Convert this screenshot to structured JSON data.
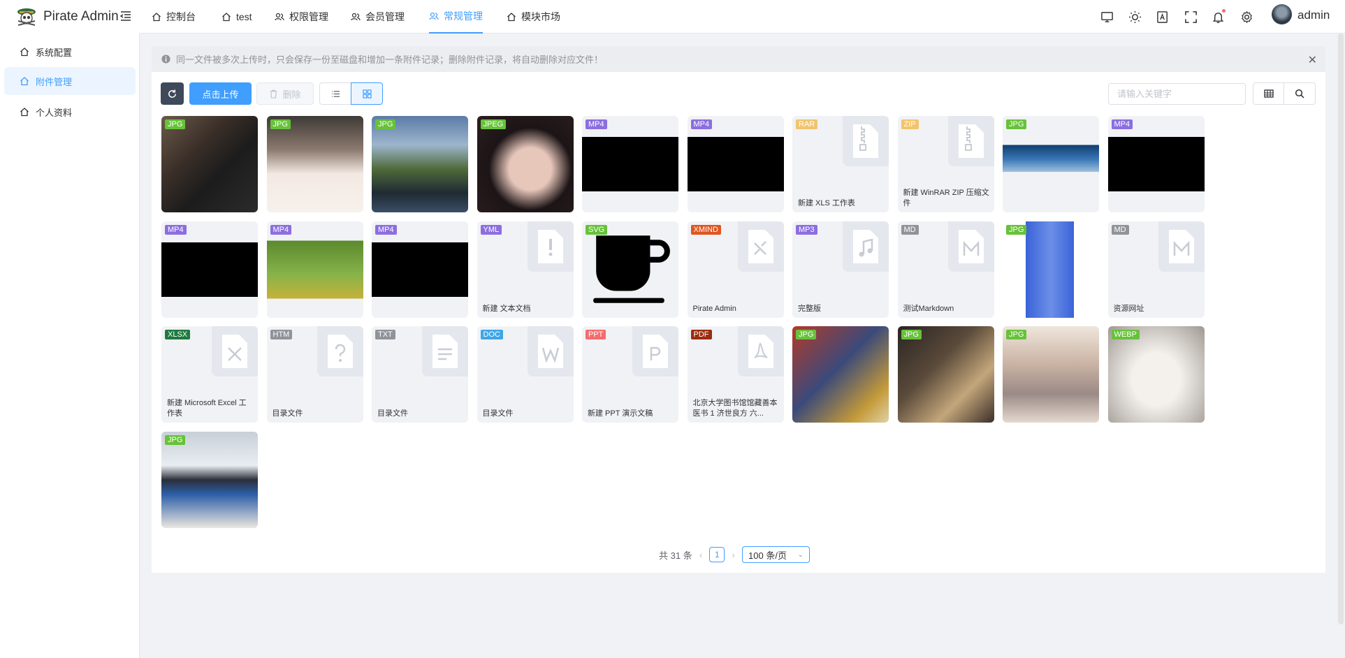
{
  "app": {
    "title": "Pirate Admin"
  },
  "topnav": {
    "tabs": [
      {
        "label": "控制台",
        "icon": "home-icon"
      },
      {
        "label": "test",
        "icon": "home-icon"
      },
      {
        "label": "权限管理",
        "icon": "user-group-icon"
      },
      {
        "label": "会员管理",
        "icon": "user-group-icon"
      },
      {
        "label": "常规管理",
        "icon": "user-group-icon",
        "active": true
      },
      {
        "label": "模块市场",
        "icon": "home-icon"
      }
    ],
    "username": "admin"
  },
  "sidebar": {
    "items": [
      {
        "label": "系统配置",
        "icon": "home-icon"
      },
      {
        "label": "附件管理",
        "icon": "home-icon",
        "active": true
      },
      {
        "label": "个人资料",
        "icon": "home-icon"
      }
    ]
  },
  "alert": {
    "text": "同一文件被多次上传时，只会保存一份至磁盘和增加一条附件记录；删除附件记录，将自动删除对应文件！"
  },
  "toolbar": {
    "upload_label": "点击上传",
    "delete_label": "删除",
    "search_placeholder": "请输入关键字"
  },
  "files": [
    {
      "badge": "JPG",
      "color": "#67c23a",
      "kind": "photo",
      "photo": "p1"
    },
    {
      "badge": "JPG",
      "color": "#67c23a",
      "kind": "photo",
      "photo": "p2"
    },
    {
      "badge": "JPG",
      "color": "#67c23a",
      "kind": "photo",
      "photo": "p3"
    },
    {
      "badge": "JPEG",
      "color": "#67c23a",
      "kind": "photo",
      "photo": "p4"
    },
    {
      "badge": "MP4",
      "color": "#8c6ee0",
      "kind": "video"
    },
    {
      "badge": "MP4",
      "color": "#8c6ee0",
      "kind": "video"
    },
    {
      "badge": "RAR",
      "color": "#f2c46d",
      "kind": "file",
      "icon": "zip",
      "name": "新建 XLS 工作表"
    },
    {
      "badge": "ZIP",
      "color": "#f2c46d",
      "kind": "file",
      "icon": "zip",
      "name": "新建 WinRAR ZIP 压缩文件"
    },
    {
      "badge": "JPG",
      "color": "#67c23a",
      "kind": "photo",
      "photo": "p5"
    },
    {
      "badge": "MP4",
      "color": "#8c6ee0",
      "kind": "video"
    },
    {
      "badge": "MP4",
      "color": "#8c6ee0",
      "kind": "video"
    },
    {
      "badge": "MP4",
      "color": "#8c6ee0",
      "kind": "photo",
      "photo": "bunny"
    },
    {
      "badge": "MP4",
      "color": "#8c6ee0",
      "kind": "video"
    },
    {
      "badge": "YML",
      "color": "#8c6ee0",
      "kind": "file",
      "icon": "exclaim",
      "name": "新建 文本文档"
    },
    {
      "badge": "SVG",
      "color": "#67c23a",
      "kind": "photo",
      "photo": "cup"
    },
    {
      "badge": "XMIND",
      "color": "#e0551f",
      "kind": "file",
      "icon": "xmind",
      "name": "Pirate Admin"
    },
    {
      "badge": "MP3",
      "color": "#8c6ee0",
      "kind": "file",
      "icon": "music",
      "name": "完整版"
    },
    {
      "badge": "MD",
      "color": "#909399",
      "kind": "file",
      "icon": "md",
      "name": "测试Markdown"
    },
    {
      "badge": "JPG",
      "color": "#67c23a",
      "kind": "photo",
      "photo": "poster"
    },
    {
      "badge": "MD",
      "color": "#909399",
      "kind": "file",
      "icon": "md",
      "name": "资源网址"
    },
    {
      "badge": "XLSX",
      "color": "#1f7a3f",
      "kind": "file",
      "icon": "x",
      "name": "新建 Microsoft Excel 工作表"
    },
    {
      "badge": "HTM",
      "color": "#909399",
      "kind": "file",
      "icon": "question",
      "name": "目录文件"
    },
    {
      "badge": "TXT",
      "color": "#909399",
      "kind": "file",
      "icon": "text",
      "name": "目录文件"
    },
    {
      "badge": "DOC",
      "color": "#3ea6e8",
      "kind": "file",
      "icon": "w",
      "name": "目录文件"
    },
    {
      "badge": "PPT",
      "color": "#f56c6c",
      "kind": "file",
      "icon": "p",
      "name": "新建 PPT 演示文稿"
    },
    {
      "badge": "PDF",
      "color": "#9b2d0f",
      "kind": "file",
      "icon": "pdf",
      "name": "北京大学图书馆馆藏善本医书 1 济世良方 六..."
    },
    {
      "badge": "JPG",
      "color": "#67c23a",
      "kind": "photo",
      "photo": "p6"
    },
    {
      "badge": "JPG",
      "color": "#67c23a",
      "kind": "photo",
      "photo": "p7"
    },
    {
      "badge": "JPG",
      "color": "#67c23a",
      "kind": "photo",
      "photo": "p8"
    },
    {
      "badge": "WEBP",
      "color": "#67c23a",
      "kind": "photo",
      "photo": "cat"
    },
    {
      "badge": "JPG",
      "color": "#67c23a",
      "kind": "photo",
      "photo": "p9"
    }
  ],
  "pagination": {
    "total": "共 31 条",
    "page": "1",
    "page_size": "100 条/页"
  }
}
